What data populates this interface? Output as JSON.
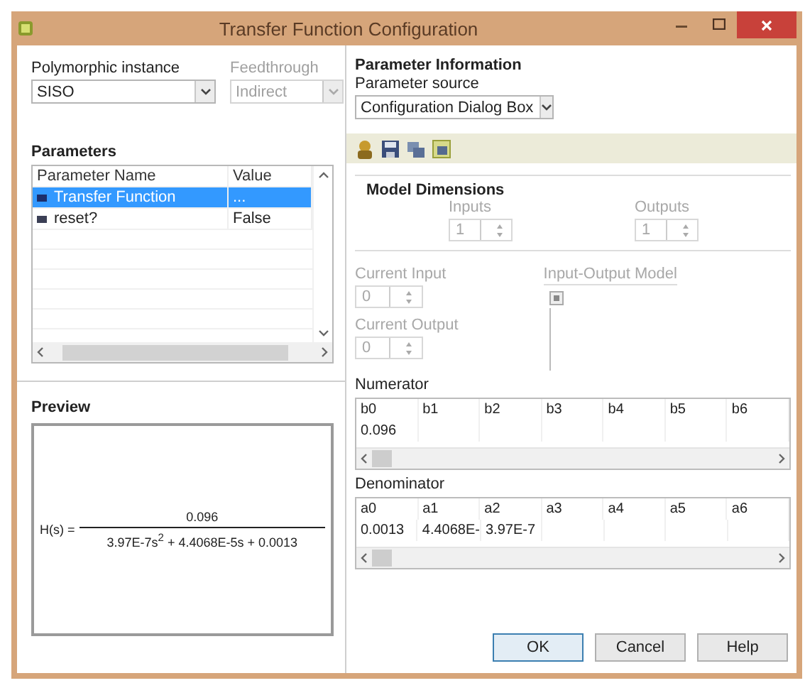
{
  "window": {
    "title": "Transfer Function Configuration"
  },
  "polymorphic_instance": {
    "label": "Polymorphic instance",
    "value": "SISO",
    "disabled": false
  },
  "feedthrough": {
    "label": "Feedthrough",
    "value": "Indirect",
    "disabled": true
  },
  "parameters": {
    "title": "Parameters",
    "columns": [
      "Parameter Name",
      "Value"
    ],
    "rows": [
      {
        "name": "Transfer Function",
        "value": "...",
        "selected": true
      },
      {
        "name": "reset?",
        "value": "False",
        "selected": false
      }
    ]
  },
  "preview": {
    "title": "Preview",
    "lhs": "H(s) =",
    "numerator": "0.096",
    "denominator": "3.97E-7s$^{2}$ + 4.4068E-5s + 0.0013"
  },
  "parameter_information": {
    "title": "Parameter Information",
    "source_label": "Parameter source",
    "source_value": "Configuration Dialog Box"
  },
  "model_dimensions": {
    "title": "Model Dimensions",
    "inputs": {
      "label": "Inputs",
      "value": "1",
      "disabled": true
    },
    "outputs": {
      "label": "Outputs",
      "value": "1",
      "disabled": true
    }
  },
  "current_input": {
    "label": "Current Input",
    "value": "0",
    "disabled": true
  },
  "current_output": {
    "label": "Current Output",
    "value": "0",
    "disabled": true
  },
  "io_model": {
    "label": "Input-Output Model",
    "disabled": true
  },
  "numerator": {
    "title": "Numerator",
    "columns": [
      "b0",
      "b1",
      "b2",
      "b3",
      "b4",
      "b5",
      "b6"
    ],
    "values": [
      "0.096"
    ]
  },
  "denominator": {
    "title": "Denominator",
    "columns": [
      "a0",
      "a1",
      "a2",
      "a3",
      "a4",
      "a5",
      "a6"
    ],
    "values": [
      "0.0013",
      "4.4068E-",
      "3.97E-7"
    ]
  },
  "buttons": [
    {
      "label": "OK",
      "default": true
    },
    {
      "label": "Cancel",
      "default": false
    },
    {
      "label": "Help",
      "default": false
    }
  ]
}
